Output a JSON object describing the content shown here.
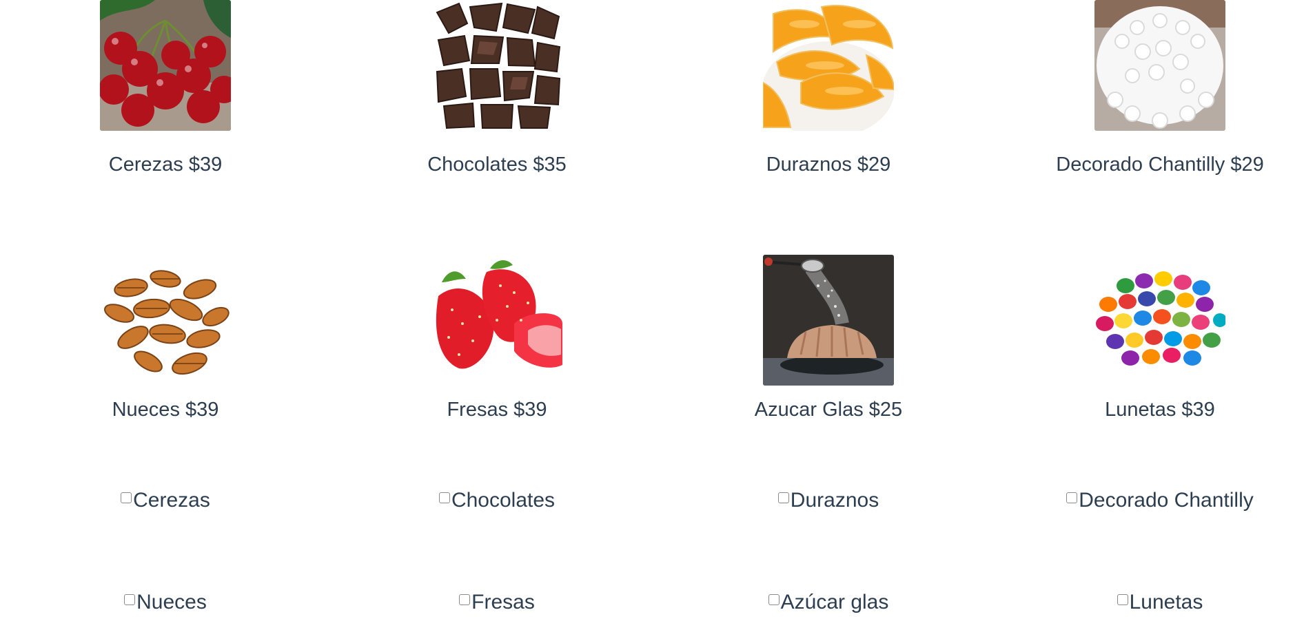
{
  "products": [
    {
      "label": "Cerezas $39",
      "image": "cherries-image"
    },
    {
      "label": "Chocolates $35",
      "image": "chocolate-image"
    },
    {
      "label": "Duraznos $29",
      "image": "peaches-image"
    },
    {
      "label": "Decorado Chantilly $29",
      "image": "chantilly-cake-image"
    },
    {
      "label": "Nueces $39",
      "image": "pecans-image"
    },
    {
      "label": "Fresas $39",
      "image": "strawberries-image"
    },
    {
      "label": "Azucar Glas $25",
      "image": "powdered-sugar-cake-image"
    },
    {
      "label": "Lunetas $39",
      "image": "candies-image"
    }
  ],
  "options": [
    {
      "label": "Cerezas",
      "checked": false
    },
    {
      "label": "Chocolates",
      "checked": false
    },
    {
      "label": "Duraznos",
      "checked": false
    },
    {
      "label": "Decorado Chantilly",
      "checked": false
    },
    {
      "label": "Nueces",
      "checked": false
    },
    {
      "label": "Fresas",
      "checked": false
    },
    {
      "label": "Azúcar glas",
      "checked": false
    },
    {
      "label": "Lunetas",
      "checked": false
    }
  ]
}
